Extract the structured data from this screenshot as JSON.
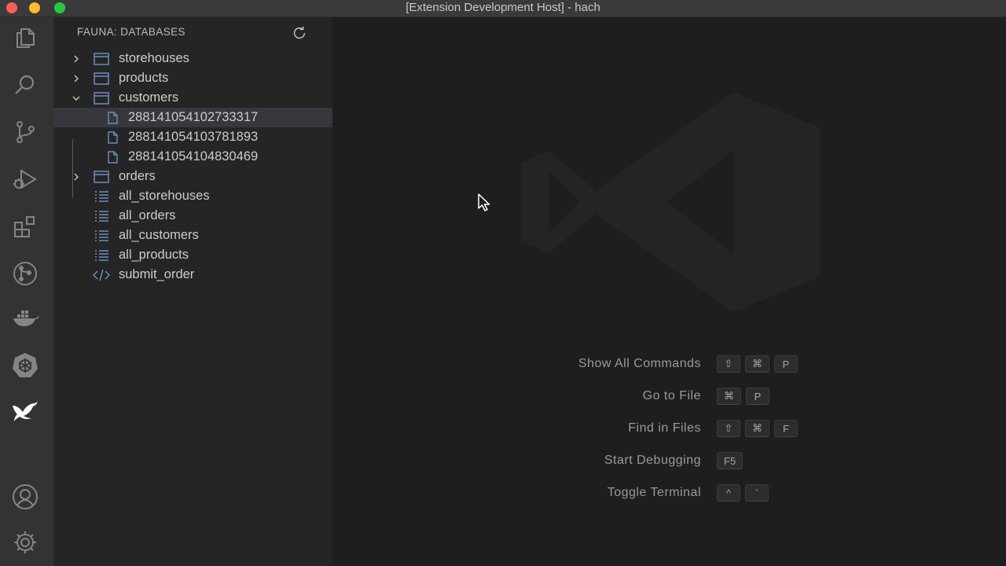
{
  "window": {
    "title": "[Extension Development Host] - hach"
  },
  "activity_bar": {
    "items": [
      {
        "name": "explorer-icon"
      },
      {
        "name": "search-icon"
      },
      {
        "name": "source-control-icon"
      },
      {
        "name": "run-debug-icon"
      },
      {
        "name": "extensions-icon"
      },
      {
        "name": "git-graph-icon"
      },
      {
        "name": "docker-icon"
      },
      {
        "name": "kubernetes-icon"
      },
      {
        "name": "fauna-bird-icon"
      }
    ],
    "bottom": [
      {
        "name": "account-icon"
      },
      {
        "name": "settings-gear-icon"
      }
    ]
  },
  "sidebar": {
    "header": "FAUNA: DATABASES",
    "refresh_icon": "refresh-icon",
    "items": [
      {
        "label": "storehouses",
        "type": "collection",
        "expanded": false
      },
      {
        "label": "products",
        "type": "collection",
        "expanded": false
      },
      {
        "label": "customers",
        "type": "collection",
        "expanded": true
      },
      {
        "label": "288141054102733317",
        "type": "document",
        "selected": true
      },
      {
        "label": "288141054103781893",
        "type": "document"
      },
      {
        "label": "288141054104830469",
        "type": "document"
      },
      {
        "label": "orders",
        "type": "collection",
        "expanded": false
      },
      {
        "label": "all_storehouses",
        "type": "index"
      },
      {
        "label": "all_orders",
        "type": "index"
      },
      {
        "label": "all_customers",
        "type": "index"
      },
      {
        "label": "all_products",
        "type": "index"
      },
      {
        "label": "submit_order",
        "type": "function"
      }
    ]
  },
  "editor": {
    "shortcuts": [
      {
        "label": "Show All Commands",
        "keys": [
          "⇧",
          "⌘",
          "P"
        ]
      },
      {
        "label": "Go to File",
        "keys": [
          "⌘",
          "P"
        ]
      },
      {
        "label": "Find in Files",
        "keys": [
          "⇧",
          "⌘",
          "F"
        ]
      },
      {
        "label": "Start Debugging",
        "keys": [
          "F5"
        ]
      },
      {
        "label": "Toggle Terminal",
        "keys": [
          "^",
          "`"
        ]
      }
    ]
  },
  "colors": {
    "accent_icon": "#6c8fbd",
    "sidebar_bg": "#252526",
    "editor_bg": "#1e1e1e",
    "activitybar_bg": "#333333"
  }
}
